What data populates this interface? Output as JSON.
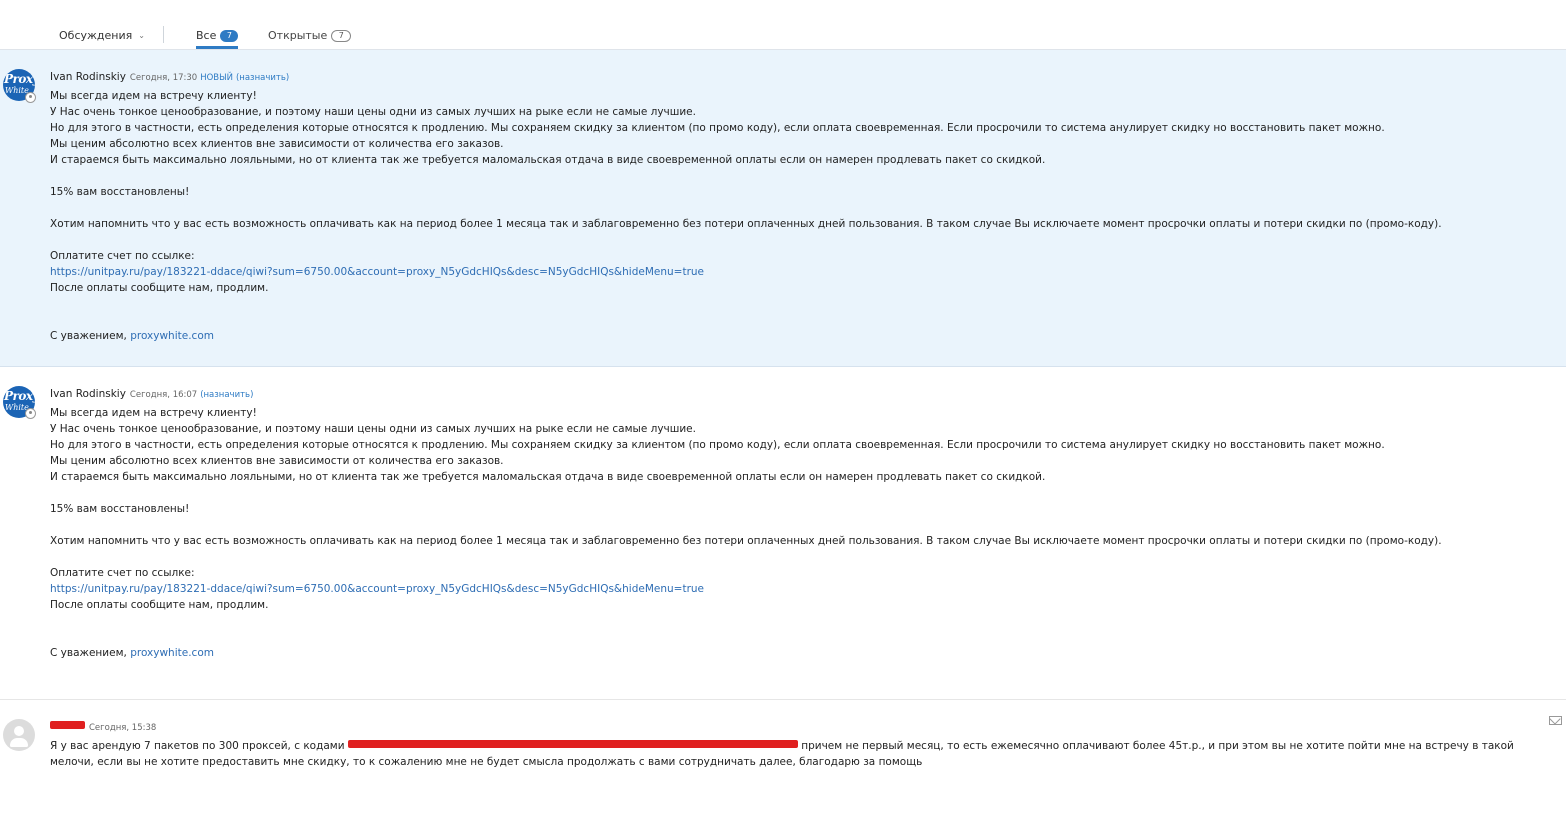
{
  "tabs": {
    "discussions": "Обсуждения",
    "all": "Все",
    "all_count": "7",
    "open": "Открытые",
    "open_count": "7"
  },
  "messages": [
    {
      "avatar_text": [
        "Proxy",
        "White"
      ],
      "author": "Ivan Rodinskiy",
      "time": "Сегодня, 17:30",
      "status": "НОВЫЙ",
      "assign": "(назначить)",
      "lines": {
        "l1": "Мы всегда идем на встречу клиенту!",
        "l2": "У Нас очень тонкое ценообразование, и поэтому наши цены одни из самых лучших на рыке если не самые лучшие.",
        "l3": "Но для этого в частности, есть определения которые относятся к продлению. Мы сохраняем скидку за клиентом (по промо коду), если оплата своевременная. Если просрочили то система анулирует скидку но восстановить пакет можно.",
        "l4": "Мы ценим абсолютно всех клиентов вне зависимости от количества его заказов.",
        "l5": "И стараемся быть максимально лояльными, но от клиента так же требуется маломальская отдача в виде своевременной оплаты если он намерен продлевать пакет со скидкой.",
        "l6": "15% вам восстановлены!",
        "l7": "Хотим напомнить что у вас есть возможность оплачивать как на период более 1 месяца так и заблаговременно без потери оплаченных дней пользования. В таком случае Вы исключаете момент просрочки оплаты и потери скидки по (промо-коду).",
        "l8": "Оплатите счет по ссылке:",
        "link": "https://unitpay.ru/pay/183221-ddace/qiwi?sum=6750.00&account=proxy_N5yGdcHIQs&desc=N5yGdcHIQs&hideMenu=true",
        "l9": "После оплаты сообщите нам, продлим.",
        "sign": "С уважением,",
        "site": "proxywhite.com"
      }
    },
    {
      "avatar_text": [
        "Proxy",
        "White"
      ],
      "author": "Ivan Rodinskiy",
      "time": "Сегодня, 16:07",
      "assign": "(назначить)",
      "lines": {
        "l1": "Мы всегда идем на встречу клиенту!",
        "l2": "У Нас очень тонкое ценообразование, и поэтому наши цены одни из самых лучших на рыке если не самые лучшие.",
        "l3": "Но для этого в частности, есть определения которые относятся к продлению. Мы сохраняем скидку за клиентом (по промо коду), если оплата своевременная. Если просрочили то система анулирует скидку но восстановить пакет можно.",
        "l4": "Мы ценим абсолютно всех клиентов вне зависимости от количества его заказов.",
        "l5": "И стараемся быть максимально лояльными, но от клиента так же требуется маломальская отдача в виде своевременной оплаты если он намерен продлевать пакет со скидкой.",
        "l6": "15% вам восстановлены!",
        "l7": "Хотим напомнить что у вас есть возможность оплачивать как на период более 1 месяца так и заблаговременно без потери оплаченных дней пользования. В таком случае Вы исключаете момент просрочки оплаты и потери скидки по (промо-коду).",
        "l8": "Оплатите счет по ссылке:",
        "link": "https://unitpay.ru/pay/183221-ddace/qiwi?sum=6750.00&account=proxy_N5yGdcHIQs&desc=N5yGdcHIQs&hideMenu=true",
        "l9": "После оплаты сообщите нам, продлим.",
        "sign": "С уважением,",
        "site": "proxywhite.com"
      }
    },
    {
      "time": "Сегодня, 15:38",
      "text_before": "Я у вас арендую 7 пакетов по 300 проксей, с кодами",
      "text_after": "причем не первый месяц, то есть ежемесячно оплачивают более 45т.р., и при этом вы не хотите пойти мне на встречу в такой мелочи, если вы не хотите предоставить мне скидку, то к сожалению мне не будет смысла продолжать с вами сотрудничать далее, благодарю за помощь"
    }
  ],
  "colors": {
    "accent": "#2e7bc4",
    "highlight_bg": "#eaf4fc",
    "redaction": "#e02020"
  },
  "icons": [
    "chevron-down-icon",
    "proxywhite-logo",
    "user-icon",
    "mail-icon"
  ]
}
